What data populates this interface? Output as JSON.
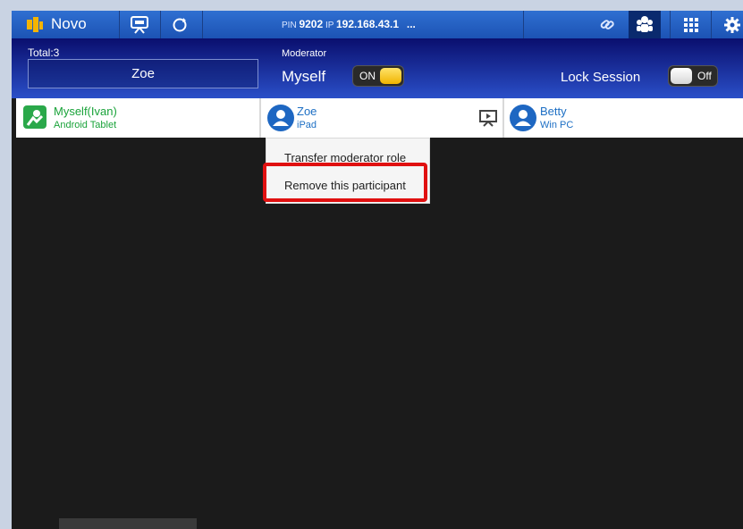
{
  "topbar": {
    "app_title": "Novo",
    "pin_label": "PIN",
    "pin_value": "9202",
    "ip_label": "IP",
    "ip_value": "192.168.43.1",
    "more": "...",
    "accent": "#2f6fd1"
  },
  "session": {
    "total_label": "Total:3",
    "selected_name": "Zoe",
    "moderator_label": "Moderator",
    "moderator_name": "Myself",
    "moderator_toggle": "ON",
    "lock_label": "Lock Session",
    "lock_toggle": "Off"
  },
  "participants": [
    {
      "name": "Myself(Ivan)",
      "device": "Android Tablet",
      "color": "#1aa33a"
    },
    {
      "name": "Zoe",
      "device": "iPad",
      "color": "#1d6fc4"
    },
    {
      "name": "Betty",
      "device": "Win PC",
      "color": "#1d6fc4"
    }
  ],
  "menu": {
    "items": [
      "Transfer moderator role",
      "Remove this participant"
    ],
    "highlight_color": "#e01010"
  },
  "icons": [
    "novo-logo-icon",
    "presentation-icon",
    "refresh-icon",
    "link-icon",
    "people-icon",
    "grid-icon",
    "settings-icon",
    "user-avatar-icon",
    "android-avatar-icon",
    "projector-icon"
  ]
}
